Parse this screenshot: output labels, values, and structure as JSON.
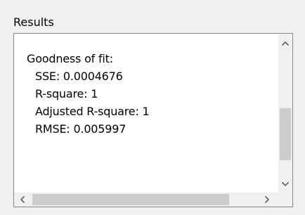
{
  "results_panel": {
    "title": "Results",
    "lines": [
      "Goodness of fit:",
      "SSE: 0.0004676",
      "R-square: 1",
      "Adjusted R-square: 1",
      "RMSE: 0.005997"
    ]
  },
  "icons": {
    "scroll_up": "chevron-up-icon",
    "scroll_down": "chevron-down-icon",
    "scroll_left": "chevron-left-icon",
    "scroll_right": "chevron-right-icon"
  },
  "colors": {
    "background": "#f0f0f0",
    "textbox": "#ffffff",
    "border": "#828790",
    "scroll_thumb": "#cdcdcd",
    "arrow": "#606060"
  }
}
